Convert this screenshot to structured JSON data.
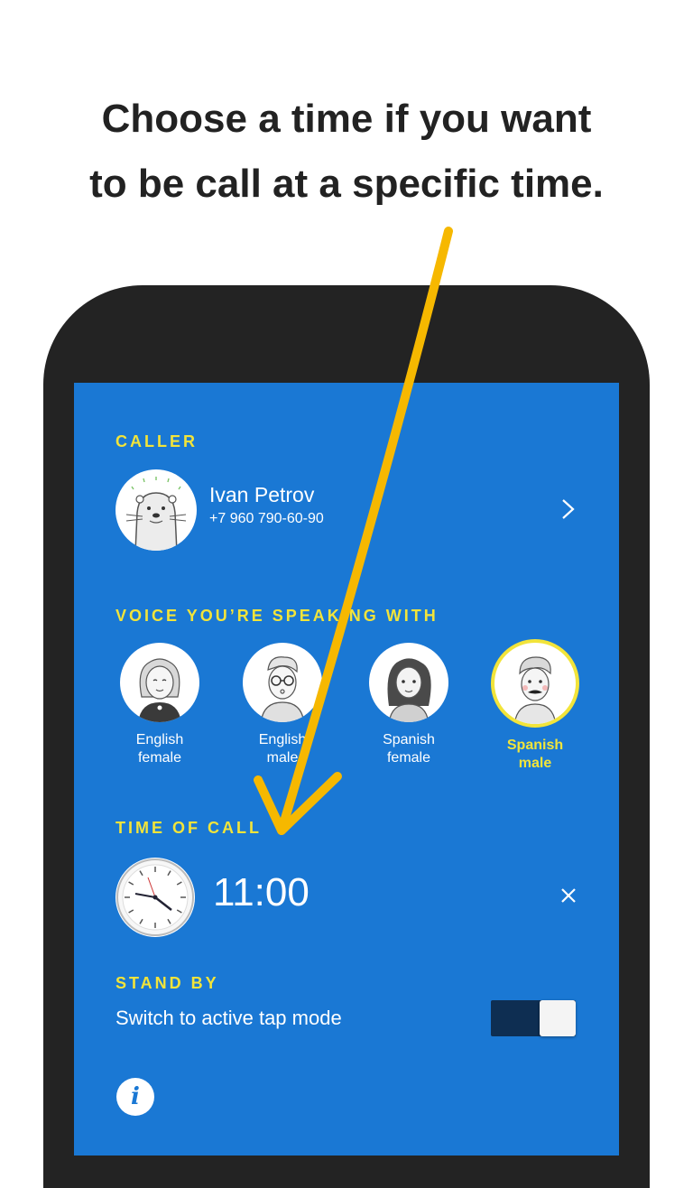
{
  "headline": {
    "line1": "Choose a time if you want",
    "line2": "to be call at a specific time."
  },
  "caller": {
    "section_title": "CALLER",
    "name": "Ivan Petrov",
    "phone": "+7 960 790-60-90",
    "avatar_icon": "otter-avatar-icon",
    "chevron_icon": "chevron-right-icon"
  },
  "voices": {
    "section_title": "VOICE YOU’RE SPEAKING WITH",
    "items": [
      {
        "line1": "English",
        "line2": "female",
        "selected": false
      },
      {
        "line1": "English",
        "line2": "male",
        "selected": false
      },
      {
        "line1": "Spanish",
        "line2": "female",
        "selected": false
      },
      {
        "line1": "Spanish",
        "line2": "male",
        "selected": true
      }
    ]
  },
  "time_of_call": {
    "section_title": "TIME OF CALL",
    "value": "11:00",
    "clock_icon": "clock-icon",
    "clear_icon": "close-icon"
  },
  "standby": {
    "section_title": "STAND BY",
    "label": "Switch to active tap mode",
    "toggle_on": true
  },
  "info_icon": "info-icon",
  "colors": {
    "screen_bg": "#1a78d4",
    "accent_yellow": "#f2e43a",
    "phone_frame": "#232323",
    "arrow": "#f6b800",
    "toggle_track": "#0e2e52"
  }
}
